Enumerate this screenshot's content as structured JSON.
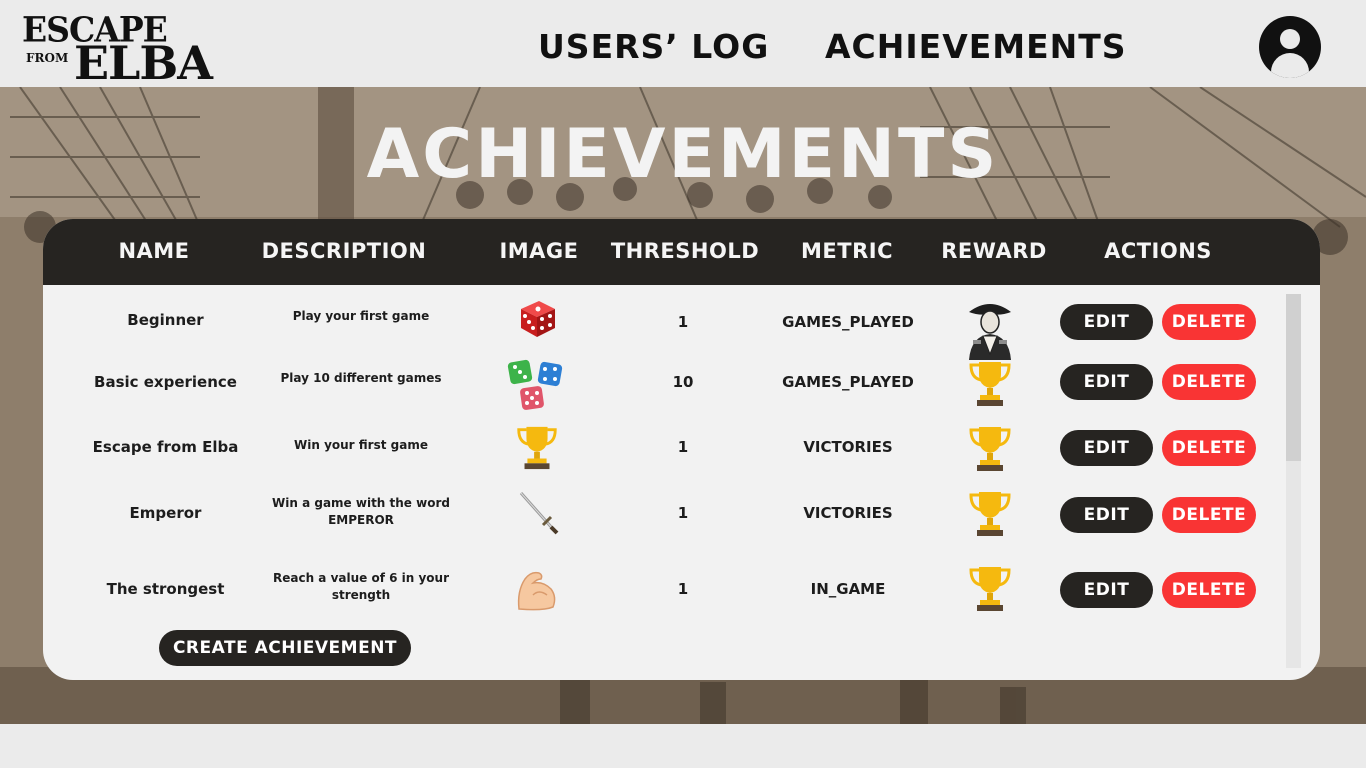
{
  "brand": {
    "line1": "ESCAPE",
    "line2": "FROM",
    "line3": "ELBA"
  },
  "nav": {
    "users_log": "USERS’ LOG",
    "achievements": "ACHIEVEMENTS"
  },
  "page": {
    "title": "ACHIEVEMENTS"
  },
  "table": {
    "headers": {
      "name": "NAME",
      "description": "DESCRIPTION",
      "image": "IMAGE",
      "threshold": "THRESHOLD",
      "metric": "METRIC",
      "reward": "REWARD",
      "actions": "ACTIONS"
    },
    "rows": [
      {
        "name": "Beginner",
        "description": "Play your first game",
        "image": "red-dice-icon",
        "threshold": "1",
        "metric": "GAMES_PLAYED",
        "reward": "napoleon-portrait-icon"
      },
      {
        "name": "Basic experience",
        "description": "Play 10 different games",
        "image": "three-dice-icon",
        "threshold": "10",
        "metric": "GAMES_PLAYED",
        "reward": "trophy-icon"
      },
      {
        "name": "Escape from Elba",
        "description": "Win your first game",
        "image": "trophy-icon",
        "threshold": "1",
        "metric": "VICTORIES",
        "reward": "trophy-icon"
      },
      {
        "name": "Emperor",
        "description": "Win a game with the word EMPEROR",
        "image": "sword-icon",
        "threshold": "1",
        "metric": "VICTORIES",
        "reward": "trophy-icon"
      },
      {
        "name": "The strongest",
        "description": "Reach a value of 6 in your strength",
        "image": "flexed-biceps-icon",
        "threshold": "1",
        "metric": "IN_GAME",
        "reward": "trophy-icon"
      }
    ],
    "edit_label": "EDIT",
    "delete_label": "DELETE"
  },
  "create_button": "CREATE ACHIEVEMENT",
  "colors": {
    "header_bar": "#262421",
    "delete": "#f93434",
    "panel": "#f2f2f2",
    "page_bg": "#ebebeb"
  }
}
